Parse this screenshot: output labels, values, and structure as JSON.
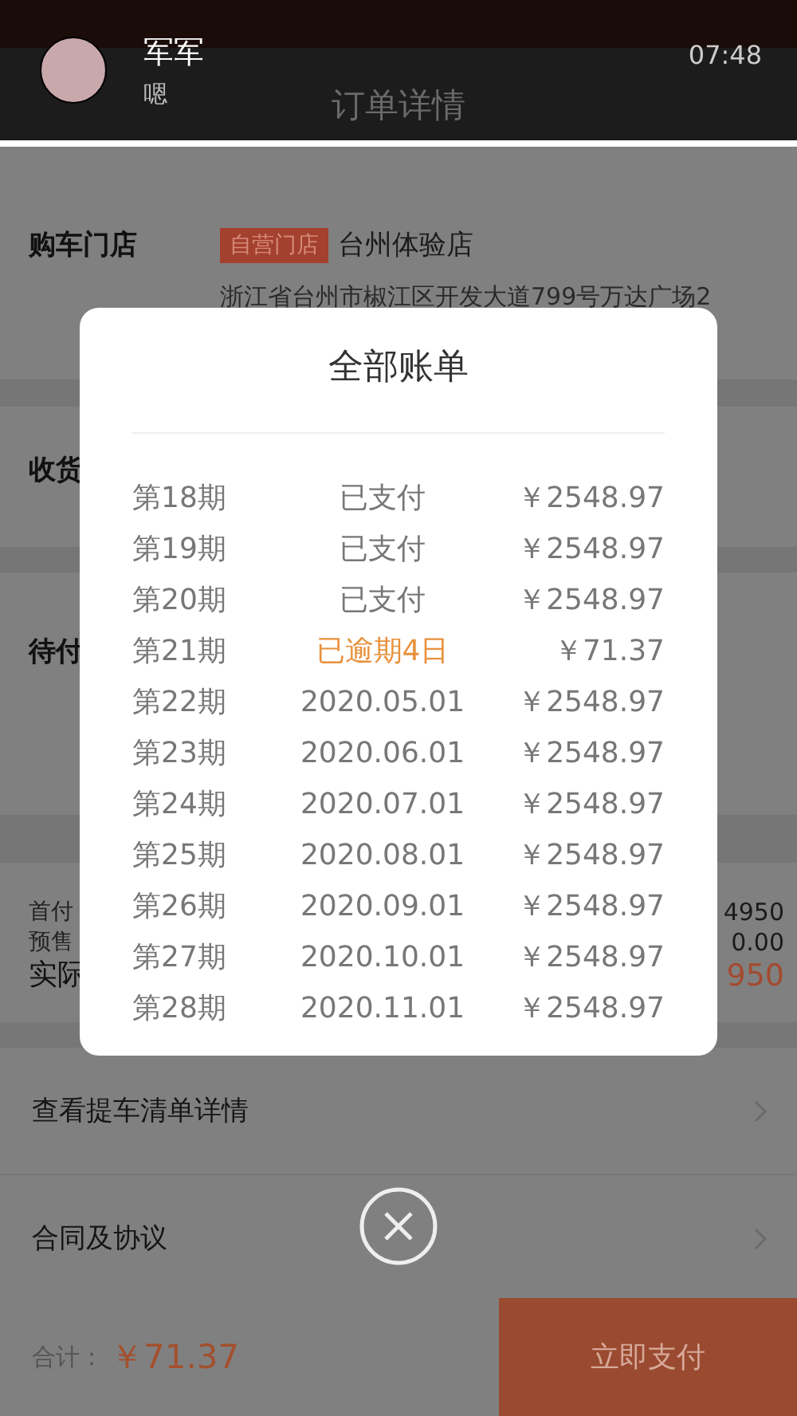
{
  "notification": {
    "sender": "军军",
    "message": "嗯",
    "time": "07:48"
  },
  "header": {
    "title": "订单详情"
  },
  "store": {
    "label": "购车门店",
    "tag": "自营门店",
    "name": "台州体验店",
    "address": "浙江省台州市椒江区开发大道799号万达广场2"
  },
  "partial_sections": [
    {
      "label": "收货"
    },
    {
      "label": "待付"
    }
  ],
  "summary": [
    {
      "label": "首付",
      "value": "4950",
      "kind": "plain"
    },
    {
      "label": "预售",
      "value": "0.00",
      "kind": "plain"
    },
    {
      "label": "实际",
      "value": "950",
      "kind": "total"
    }
  ],
  "links": [
    {
      "label": "查看提车清单详情"
    },
    {
      "label": "合同及协议"
    }
  ],
  "footer": {
    "total_label": "合计：",
    "total": "￥71.37",
    "pay_button": "立即支付"
  },
  "bill_modal": {
    "title": "全部账单",
    "rows": [
      {
        "period": "第18期",
        "status": "已支付",
        "amount": "￥2548.97",
        "overdue": false
      },
      {
        "period": "第19期",
        "status": "已支付",
        "amount": "￥2548.97",
        "overdue": false
      },
      {
        "period": "第20期",
        "status": "已支付",
        "amount": "￥2548.97",
        "overdue": false
      },
      {
        "period": "第21期",
        "status": "已逾期4日",
        "amount": "￥71.37",
        "overdue": true
      },
      {
        "period": "第22期",
        "status": "2020.05.01",
        "amount": "￥2548.97",
        "overdue": false
      },
      {
        "period": "第23期",
        "status": "2020.06.01",
        "amount": "￥2548.97",
        "overdue": false
      },
      {
        "period": "第24期",
        "status": "2020.07.01",
        "amount": "￥2548.97",
        "overdue": false
      },
      {
        "period": "第25期",
        "status": "2020.08.01",
        "amount": "￥2548.97",
        "overdue": false
      },
      {
        "period": "第26期",
        "status": "2020.09.01",
        "amount": "￥2548.97",
        "overdue": false
      },
      {
        "period": "第27期",
        "status": "2020.10.01",
        "amount": "￥2548.97",
        "overdue": false
      },
      {
        "period": "第28期",
        "status": "2020.11.01",
        "amount": "￥2548.97",
        "overdue": false
      }
    ]
  }
}
